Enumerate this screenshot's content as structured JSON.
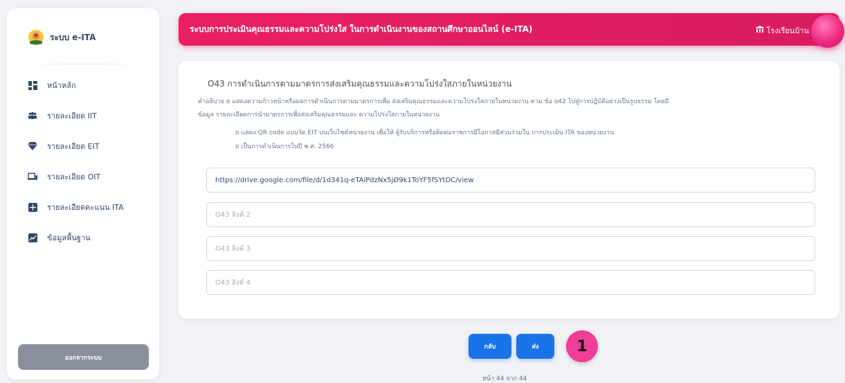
{
  "sidebar": {
    "brand": "ระบบ e-ITA",
    "items": [
      {
        "label": "หน้าหลัก",
        "icon": "dashboard-icon"
      },
      {
        "label": "รายละเอียด IIT",
        "icon": "users-icon"
      },
      {
        "label": "รายละเอียด EIT",
        "icon": "diamond-icon"
      },
      {
        "label": "รายละเอียด OIT",
        "icon": "laptop-icon"
      },
      {
        "label": "รายละเอียดคะแนน ITA",
        "icon": "grid-icon"
      },
      {
        "label": "ข้อมูลพื้นฐาน",
        "icon": "chart-icon"
      }
    ],
    "logout": "ออกจากระบบ"
  },
  "header": {
    "title": "ระบบการประเมินคุณธรรมและความโปร่งใส ในการดำเนินงานของสถานศึกษาออนไลน์ (e-ITA)",
    "school": "โรงเรียนบ้าน"
  },
  "question": {
    "title": "O43 การดำเนินการตามมาตรการส่งเสริมคุณธรรมและความโปร่งใสภายในหน่วยงาน",
    "desc_line1": "คำอธิบาย o แสดงความก้าวหน้าหรือผลการดำเนินการตามมาตรการเพื่อ ส่งเสริมคุณธรรมและความโปร่งใสภายในหน่วยงาน ตาม ข้อ o42 ไปสู่การปฏิบัติอย่างเป็นรูปธรรม โดยมี",
    "desc_line2": "ข้อมูล รายละเอียดการนำมาตรการเพื่อส่งเสริมคุณธรรมและ ความโปร่งใสภายในหน่วยงาน",
    "bullet1": "o แสดง QR code แบบวัด EIT บนเว็บไซต์หน่วยงาน เพื่อให้ ผู้รับบริการหรือติดต่อราชการมีโอกาสมีส่วนร่วมใน การประเมิน ITA ของหน่วยงาน",
    "bullet2": "o เป็นการดำเนินการในปี พ.ศ. 2566"
  },
  "links": [
    {
      "value": "https://drive.google.com/file/d/1d341q-eTAiPdzNx5jØ9k1ToYF5fSYtDC/view",
      "placeholder": "O43 ลิงค์ 1"
    },
    {
      "value": "",
      "placeholder": "O43 ลิงค์ 2"
    },
    {
      "value": "",
      "placeholder": "O43 ลิงค์ 3"
    },
    {
      "value": "",
      "placeholder": "O43 ลิงค์ 4"
    }
  ],
  "buttons": {
    "back": "กลับ",
    "submit": "ส่ง"
  },
  "marker": "1",
  "pager": "หน้า 44 จาก 44",
  "colors": {
    "accent": "#e91e63",
    "primary": "#1a73e8",
    "marker": "#f03d95"
  }
}
